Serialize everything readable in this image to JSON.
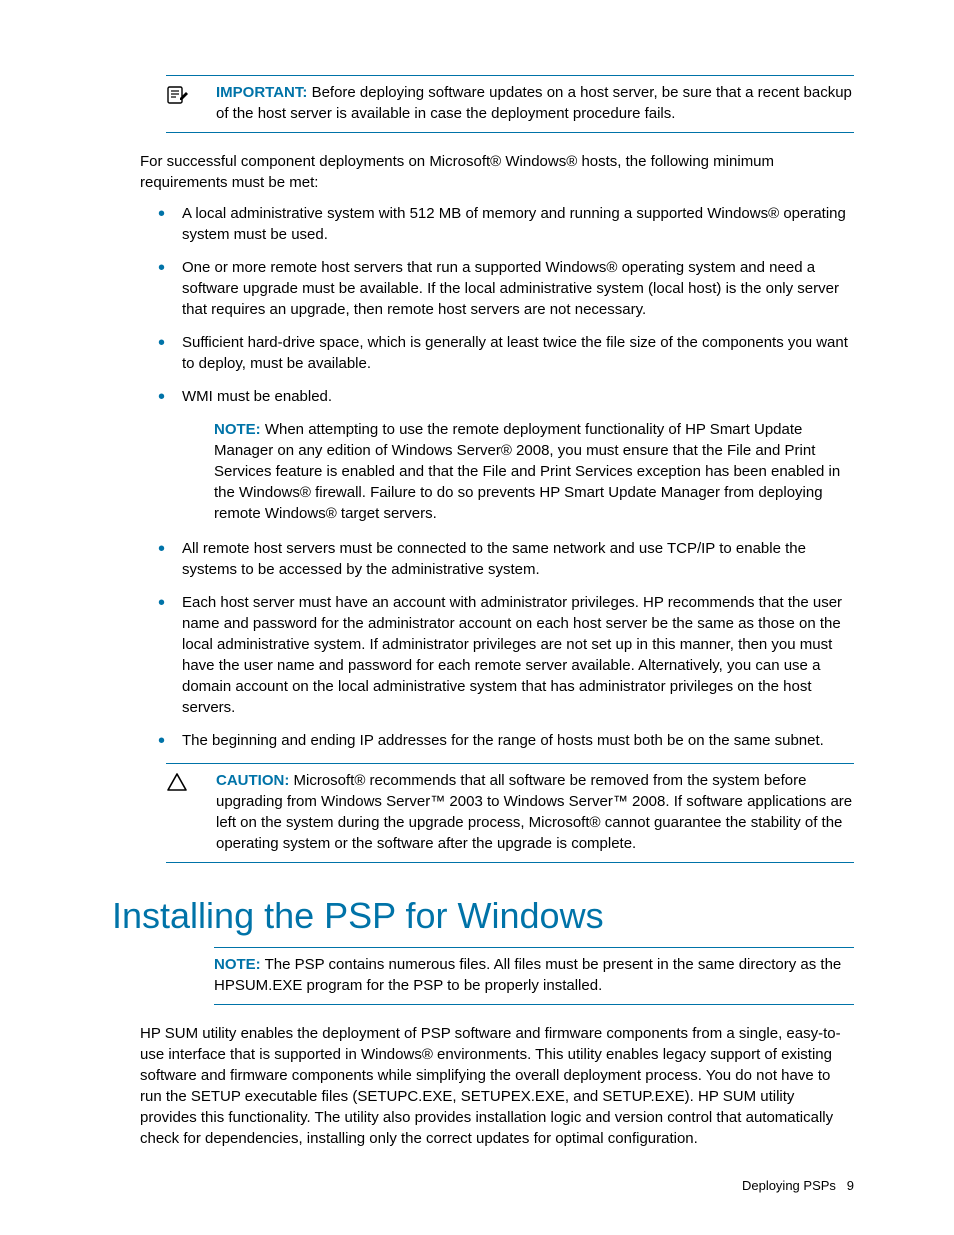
{
  "important": {
    "label": "IMPORTANT:",
    "text": "Before deploying software updates on a host server, be sure that a recent backup of the host server is available in case the deployment procedure fails."
  },
  "intro": "For successful component deployments on Microsoft® Windows® hosts, the following minimum requirements must be met:",
  "req1": "A local administrative system with 512 MB of memory and running a supported Windows® operating system must be used.",
  "req2": "One or more remote host servers that run a supported Windows® operating system and need a software upgrade must be available. If the local administrative system (local host) is the only server that requires an upgrade, then remote host servers are not necessary.",
  "req3": "Sufficient hard-drive space, which is generally at least twice the file size of the components you want to deploy, must be available.",
  "req4": "WMI must be enabled.",
  "note1": {
    "label": "NOTE:",
    "text": "When attempting to use the remote deployment functionality of HP Smart Update Manager on any edition of Windows Server® 2008, you must ensure that the File and Print Services feature is enabled and that the File and Print Services exception has been enabled in the Windows® firewall. Failure to do so prevents HP Smart Update Manager from deploying remote Windows® target servers."
  },
  "req5": "All remote host servers must be connected to the same network and use TCP/IP to enable the systems to be accessed by the administrative system.",
  "req6": "Each host server must have an account with administrator privileges. HP recommends that the user name and password for the administrator account on each host server be the same as those on the local administrative system. If administrator privileges are not set up in this manner, then you must have the user name and password for each remote server available. Alternatively, you can use a domain account on the local administrative system that has administrator privileges on the host servers.",
  "req7": "The beginning and ending IP addresses for the range of hosts must both be on the same subnet.",
  "caution": {
    "label": "CAUTION:",
    "text": "Microsoft® recommends that all software be removed from the system before upgrading from Windows Server™ 2003 to Windows Server™ 2008. If software applications are left on the system during the upgrade process, Microsoft® cannot guarantee the stability of the operating system or the software after the upgrade is complete."
  },
  "h1": "Installing the PSP for Windows",
  "note2": {
    "label": "NOTE:",
    "text": "The PSP contains numerous files. All files must be present in the same directory as the HPSUM.EXE program for the PSP to be properly installed."
  },
  "para": "HP SUM utility enables the deployment of PSP software and firmware components from a single, easy-to-use interface that is supported in Windows® environments. This utility enables legacy support of existing software and firmware components while simplifying the overall deployment process. You do not have to run the SETUP executable files (SETUPC.EXE, SETUPEX.EXE, and SETUP.EXE). HP SUM utility provides this functionality. The utility also provides installation logic and version control that automatically check for dependencies, installing only the correct updates for optimal configuration.",
  "footer": {
    "section": "Deploying PSPs",
    "page": "9"
  }
}
